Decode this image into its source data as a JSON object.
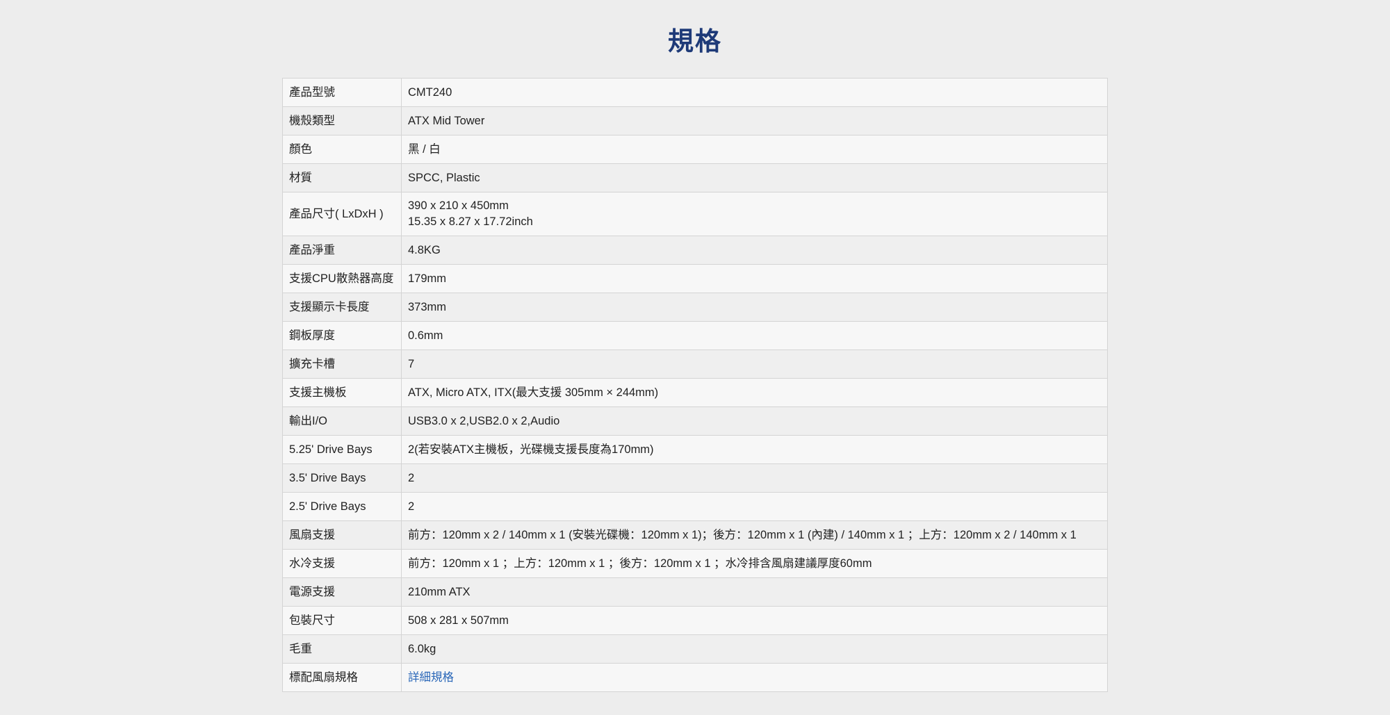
{
  "page": {
    "title": "規格"
  },
  "colors": {
    "title": "#1e3a78",
    "link": "#2a67b8",
    "background": "#ededed"
  },
  "specs": [
    {
      "label": "產品型號",
      "value": "CMT240"
    },
    {
      "label": "機殼類型",
      "value": "ATX Mid Tower"
    },
    {
      "label": "顏色",
      "value": "黑 / 白"
    },
    {
      "label": "材質",
      "value": "SPCC, Plastic"
    },
    {
      "label": "產品尺寸( LxDxH )",
      "value": "390 x 210 x 450mm",
      "value2": "15.35 x 8.27 x 17.72inch"
    },
    {
      "label": "產品淨重",
      "value": "4.8KG"
    },
    {
      "label": "支援CPU散熱器高度",
      "value": "179mm"
    },
    {
      "label": "支援顯示卡長度",
      "value": "373mm"
    },
    {
      "label": "鋼板厚度",
      "value": "0.6mm"
    },
    {
      "label": "擴充卡槽",
      "value": "7"
    },
    {
      "label": "支援主機板",
      "value": "ATX, Micro ATX, ITX(最大支援 305mm × 244mm)"
    },
    {
      "label": "輸出I/O",
      "value": "USB3.0 x 2,USB2.0 x 2,Audio"
    },
    {
      "label": "5.25' Drive Bays",
      "value": "2(若安裝ATX主機板，光碟機支援長度為170mm)"
    },
    {
      "label": "3.5' Drive Bays",
      "value": "2"
    },
    {
      "label": "2.5' Drive Bays",
      "value": "2"
    },
    {
      "label": "風扇支援",
      "value": "前方：120mm x 2 / 140mm x 1 (安裝光碟機：120mm x 1)；後方：120mm x 1 (內建) / 140mm x 1 ；上方：120mm x 2 / 140mm x 1"
    },
    {
      "label": "水冷支援",
      "value": "前方：120mm x 1 ；上方：120mm x 1 ；後方：120mm x 1 ；水冷排含風扇建議厚度60mm"
    },
    {
      "label": "電源支援",
      "value": "210mm ATX"
    },
    {
      "label": "包裝尺寸",
      "value": "508 x 281 x 507mm"
    },
    {
      "label": "毛重",
      "value": "6.0kg"
    },
    {
      "label": "標配風扇規格",
      "link": "詳細規格"
    }
  ]
}
